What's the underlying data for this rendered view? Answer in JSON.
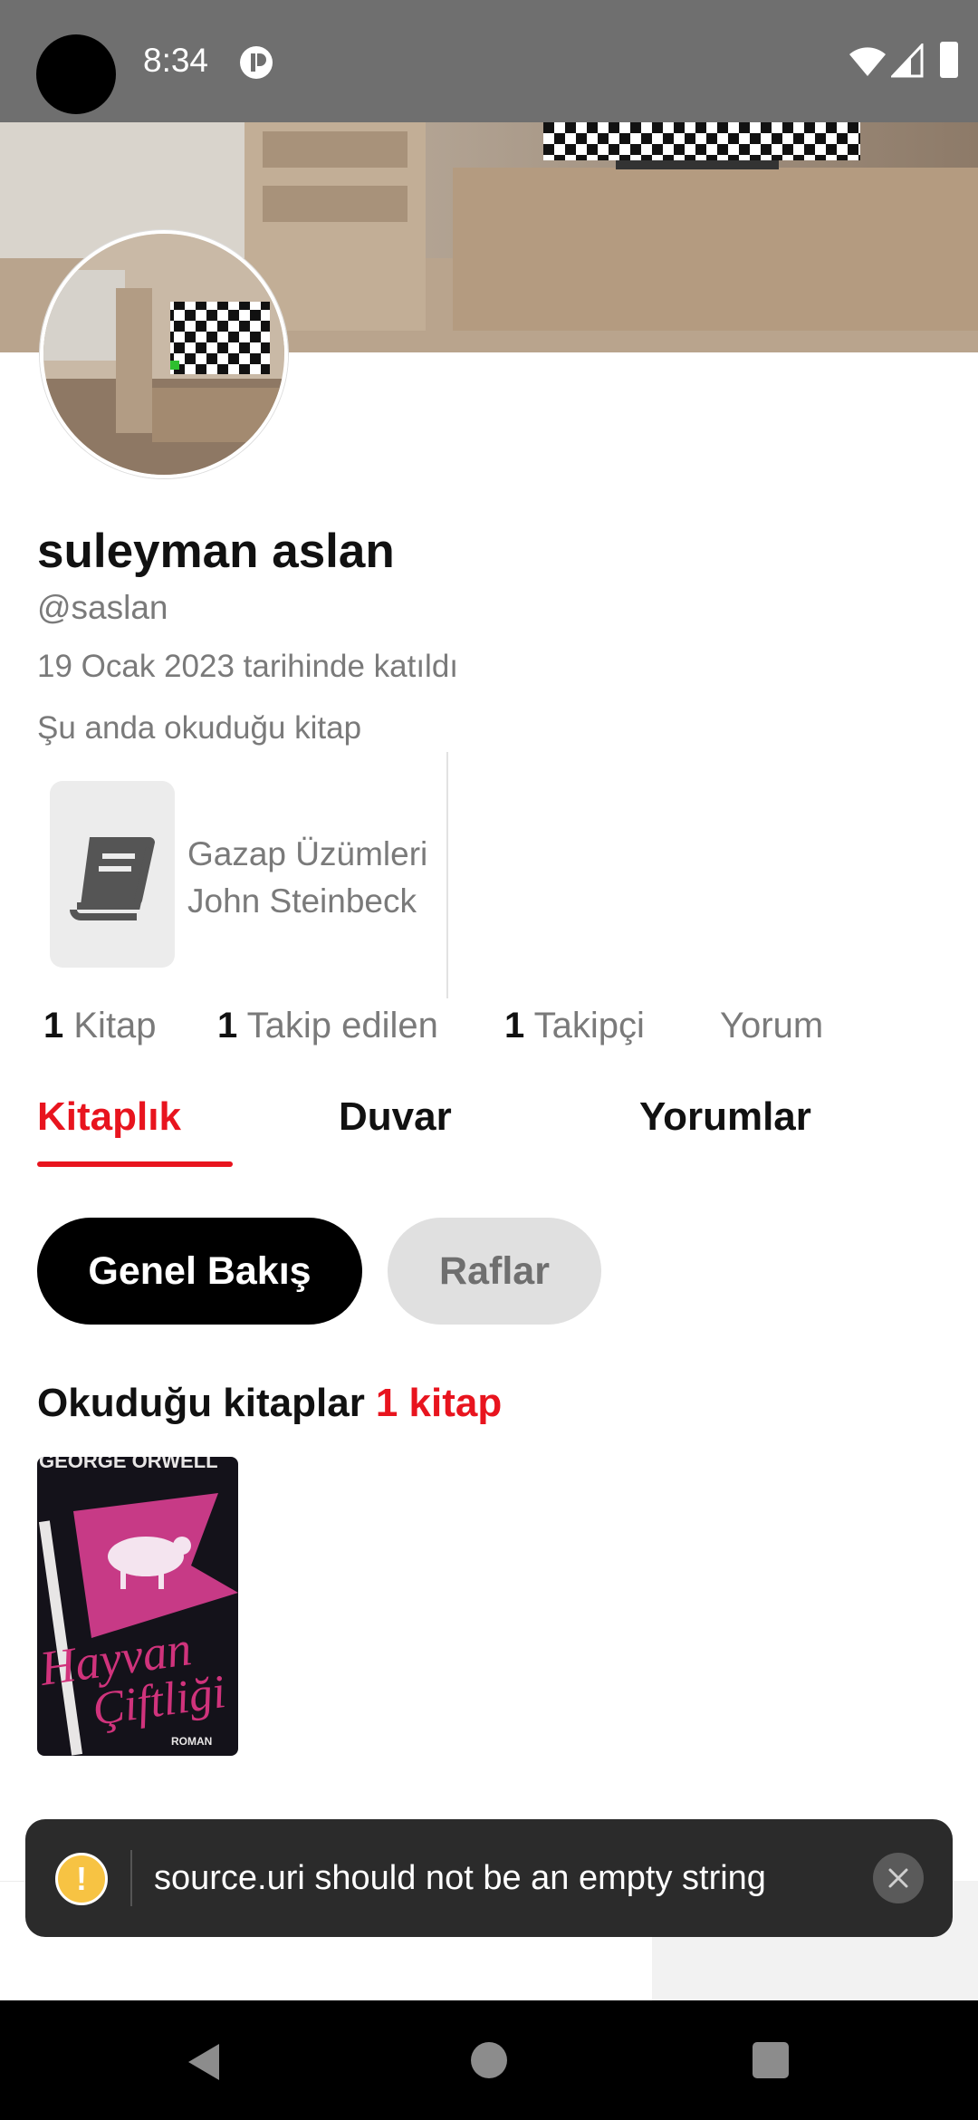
{
  "status_bar": {
    "time": "8:34"
  },
  "profile": {
    "name": "suleyman aslan",
    "handle": "@saslan",
    "joined": "19 Ocak 2023 tarihinde katıldı",
    "currently_reading_label": "Şu anda okuduğu kitap",
    "current_book": {
      "title": "Gazap Üzümleri",
      "author": "John Steinbeck"
    }
  },
  "stats": [
    {
      "count": "1",
      "label": "Kitap"
    },
    {
      "count": "1",
      "label": "Takip edilen"
    },
    {
      "count": "1",
      "label": "Takipçi"
    },
    {
      "count": "",
      "label": "Yorum"
    }
  ],
  "tabs": [
    "Kitaplık",
    "Duvar",
    "Yorumlar"
  ],
  "pills": {
    "overview": "Genel Bakış",
    "shelves": "Raflar"
  },
  "section": {
    "title": "Okuduğu kitaplar",
    "count": "1 kitap"
  },
  "book_cover": {
    "author": "GEORGE ORWELL",
    "title_line1": "Hayvan",
    "title_line2": "Çiftliği",
    "label": "ROMAN"
  },
  "toast": {
    "message": "source.uri should not be an empty string"
  },
  "colors": {
    "accent": "#e8141e",
    "status_bar": "#6f6f6f",
    "toast_bg": "#2b2b2b",
    "warning": "#f7c343"
  }
}
